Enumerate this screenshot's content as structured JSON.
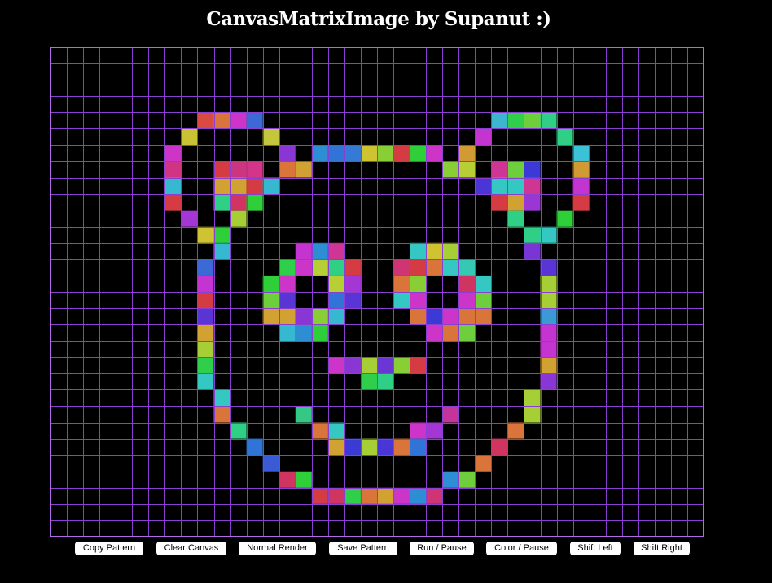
{
  "header": {
    "title": "CanvasMatrixImage by Supanut :)"
  },
  "canvas": {
    "columns": 40,
    "rows": 30,
    "background": "#000000",
    "grid_color": "#8a3fd1",
    "border_color": "#b26be8",
    "cells": [
      [
        4,
        9,
        "#d94a41"
      ],
      [
        4,
        10,
        "#d9743a"
      ],
      [
        4,
        11,
        "#cc35c8"
      ],
      [
        4,
        12,
        "#3b6ad6"
      ],
      [
        4,
        27,
        "#3db5cf"
      ],
      [
        4,
        28,
        "#2fcf4c"
      ],
      [
        4,
        29,
        "#6ecf3c"
      ],
      [
        4,
        30,
        "#2fcf85"
      ],
      [
        5,
        8,
        "#c9c234"
      ],
      [
        5,
        13,
        "#c2c73b"
      ],
      [
        5,
        26,
        "#c434d0"
      ],
      [
        5,
        31,
        "#2fcf85"
      ],
      [
        6,
        7,
        "#cc35c8"
      ],
      [
        6,
        14,
        "#8a36d4"
      ],
      [
        6,
        16,
        "#2e8ed3"
      ],
      [
        6,
        17,
        "#2f74d6"
      ],
      [
        6,
        18,
        "#347ad6"
      ],
      [
        6,
        19,
        "#cfc331"
      ],
      [
        6,
        20,
        "#87cf35"
      ],
      [
        6,
        21,
        "#d43b43"
      ],
      [
        6,
        22,
        "#2fcf3a"
      ],
      [
        6,
        23,
        "#cc35c8"
      ],
      [
        6,
        25,
        "#d19a32"
      ],
      [
        6,
        32,
        "#3cc2d6"
      ],
      [
        7,
        7,
        "#cf3583"
      ],
      [
        7,
        10,
        "#d43b43"
      ],
      [
        7,
        11,
        "#cc3580"
      ],
      [
        7,
        12,
        "#d4358b"
      ],
      [
        7,
        14,
        "#d9743a"
      ],
      [
        7,
        15,
        "#d1a131"
      ],
      [
        7,
        24,
        "#87cf35"
      ],
      [
        7,
        25,
        "#b6cf35"
      ],
      [
        7,
        27,
        "#cf3594"
      ],
      [
        7,
        28,
        "#6ecf3c"
      ],
      [
        7,
        29,
        "#3b3ad6"
      ],
      [
        7,
        32,
        "#d19a32"
      ],
      [
        8,
        7,
        "#35b8d0"
      ],
      [
        8,
        10,
        "#d1a131"
      ],
      [
        8,
        11,
        "#d1a131"
      ],
      [
        8,
        12,
        "#d43b43"
      ],
      [
        8,
        13,
        "#35b8d0"
      ],
      [
        8,
        26,
        "#4a35d6"
      ],
      [
        8,
        27,
        "#35c8c2"
      ],
      [
        8,
        28,
        "#35c8c2"
      ],
      [
        8,
        29,
        "#cf3594"
      ],
      [
        8,
        32,
        "#c434d0"
      ],
      [
        9,
        7,
        "#d43b43"
      ],
      [
        9,
        10,
        "#2fcf85"
      ],
      [
        9,
        11,
        "#cf3560"
      ],
      [
        9,
        12,
        "#2fcf3a"
      ],
      [
        9,
        27,
        "#d43b43"
      ],
      [
        9,
        28,
        "#d1a131"
      ],
      [
        9,
        29,
        "#9a36d4"
      ],
      [
        9,
        32,
        "#d43b43"
      ],
      [
        10,
        8,
        "#a336d4"
      ],
      [
        10,
        11,
        "#a6cf35"
      ],
      [
        10,
        28,
        "#2fcf85"
      ],
      [
        10,
        31,
        "#2fcf3a"
      ],
      [
        11,
        9,
        "#cfc331"
      ],
      [
        11,
        10,
        "#2fcf3a"
      ],
      [
        11,
        29,
        "#2fcf85"
      ],
      [
        11,
        30,
        "#35c8c2"
      ],
      [
        12,
        10,
        "#35b8d0"
      ],
      [
        12,
        15,
        "#c434d0"
      ],
      [
        12,
        16,
        "#2e8ed3"
      ],
      [
        12,
        17,
        "#cf3594"
      ],
      [
        12,
        22,
        "#35c8c2"
      ],
      [
        12,
        23,
        "#cfc331"
      ],
      [
        12,
        24,
        "#a6cf35"
      ],
      [
        12,
        29,
        "#7a36d4"
      ],
      [
        13,
        9,
        "#3b6ad6"
      ],
      [
        13,
        14,
        "#2fcf4c"
      ],
      [
        13,
        15,
        "#cc35c8"
      ],
      [
        13,
        16,
        "#b6cf35"
      ],
      [
        13,
        17,
        "#2fcf85"
      ],
      [
        13,
        18,
        "#d43b43"
      ],
      [
        13,
        21,
        "#cf3573"
      ],
      [
        13,
        22,
        "#d43b43"
      ],
      [
        13,
        23,
        "#d9743a"
      ],
      [
        13,
        24,
        "#35c8c2"
      ],
      [
        13,
        25,
        "#35c8b2"
      ],
      [
        13,
        30,
        "#5a35d6"
      ],
      [
        14,
        9,
        "#c434d0"
      ],
      [
        14,
        13,
        "#2fcf3a"
      ],
      [
        14,
        14,
        "#cc35c8"
      ],
      [
        14,
        17,
        "#b6cf35"
      ],
      [
        14,
        18,
        "#a336d4"
      ],
      [
        14,
        21,
        "#d9743a"
      ],
      [
        14,
        22,
        "#87cf35"
      ],
      [
        14,
        25,
        "#cf3560"
      ],
      [
        14,
        26,
        "#35c8c2"
      ],
      [
        14,
        30,
        "#a6cf35"
      ],
      [
        15,
        9,
        "#d43b43"
      ],
      [
        15,
        13,
        "#6ecf3c"
      ],
      [
        15,
        14,
        "#5a35d6"
      ],
      [
        15,
        17,
        "#2f74d6"
      ],
      [
        15,
        18,
        "#5a35d6"
      ],
      [
        15,
        21,
        "#35c8c2"
      ],
      [
        15,
        22,
        "#cc35c8"
      ],
      [
        15,
        25,
        "#cc35c8"
      ],
      [
        15,
        26,
        "#6ecf3c"
      ],
      [
        15,
        30,
        "#a6cf35"
      ],
      [
        16,
        9,
        "#5a35d6"
      ],
      [
        16,
        13,
        "#d1a131"
      ],
      [
        16,
        14,
        "#d1a131"
      ],
      [
        16,
        15,
        "#8a36d4"
      ],
      [
        16,
        16,
        "#87cf35"
      ],
      [
        16,
        17,
        "#35b8d0"
      ],
      [
        16,
        22,
        "#d9743a"
      ],
      [
        16,
        23,
        "#3b3ad6"
      ],
      [
        16,
        24,
        "#cc35c8"
      ],
      [
        16,
        25,
        "#d9743a"
      ],
      [
        16,
        26,
        "#d9743a"
      ],
      [
        16,
        30,
        "#3b9ad6"
      ],
      [
        17,
        9,
        "#d1a131"
      ],
      [
        17,
        14,
        "#35b8d0"
      ],
      [
        17,
        15,
        "#2e8ed3"
      ],
      [
        17,
        16,
        "#2fcf3a"
      ],
      [
        17,
        23,
        "#cc35c8"
      ],
      [
        17,
        24,
        "#d9743a"
      ],
      [
        17,
        25,
        "#6ecf3c"
      ],
      [
        17,
        30,
        "#c434d0"
      ],
      [
        18,
        9,
        "#a6cf35"
      ],
      [
        18,
        30,
        "#c434d0"
      ],
      [
        19,
        9,
        "#2fcf4c"
      ],
      [
        19,
        17,
        "#cc35c8"
      ],
      [
        19,
        18,
        "#8a36d4"
      ],
      [
        19,
        19,
        "#a6cf35"
      ],
      [
        19,
        20,
        "#6a36d4"
      ],
      [
        19,
        21,
        "#87cf35"
      ],
      [
        19,
        22,
        "#d43b43"
      ],
      [
        19,
        30,
        "#d1a131"
      ],
      [
        20,
        9,
        "#35c8c2"
      ],
      [
        20,
        19,
        "#2fcf4c"
      ],
      [
        20,
        20,
        "#2fcf85"
      ],
      [
        20,
        30,
        "#8a36d4"
      ],
      [
        21,
        10,
        "#35c8c2"
      ],
      [
        21,
        29,
        "#a6cf35"
      ],
      [
        22,
        10,
        "#d9743a"
      ],
      [
        22,
        15,
        "#35c885"
      ],
      [
        22,
        24,
        "#c4359a"
      ],
      [
        22,
        29,
        "#a6cf35"
      ],
      [
        23,
        11,
        "#2fcf85"
      ],
      [
        23,
        16,
        "#d9743a"
      ],
      [
        23,
        17,
        "#35c8c2"
      ],
      [
        23,
        22,
        "#cc35c8"
      ],
      [
        23,
        23,
        "#a336d4"
      ],
      [
        23,
        28,
        "#d9743a"
      ],
      [
        24,
        12,
        "#2f74d6"
      ],
      [
        24,
        17,
        "#d1a131"
      ],
      [
        24,
        18,
        "#3b3ad6"
      ],
      [
        24,
        19,
        "#a6cf35"
      ],
      [
        24,
        20,
        "#4a35d6"
      ],
      [
        24,
        21,
        "#d9743a"
      ],
      [
        24,
        22,
        "#2f74d6"
      ],
      [
        24,
        27,
        "#cf3560"
      ],
      [
        25,
        13,
        "#3b5ad6"
      ],
      [
        25,
        26,
        "#d9743a"
      ],
      [
        26,
        14,
        "#cf3560"
      ],
      [
        26,
        15,
        "#2fcf3a"
      ],
      [
        26,
        24,
        "#2e8ed3"
      ],
      [
        26,
        25,
        "#6ecf3c"
      ],
      [
        27,
        16,
        "#d43b43"
      ],
      [
        27,
        17,
        "#cf3560"
      ],
      [
        27,
        18,
        "#2fcf4c"
      ],
      [
        27,
        19,
        "#d9743a"
      ],
      [
        27,
        20,
        "#d1a131"
      ],
      [
        27,
        21,
        "#cc35c8"
      ],
      [
        27,
        22,
        "#2e8ed3"
      ],
      [
        27,
        23,
        "#cf3573"
      ]
    ]
  },
  "toolbar": {
    "copy_label": "Copy Pattern",
    "clear_label": "Clear Canvas",
    "normal_label": "Normal Render",
    "save_label": "Save Pattern",
    "run_label": "Run / Pause",
    "color_label": "Color / Pause",
    "shift_left_label": "Shift Left",
    "shift_right_label": "Shift Right"
  }
}
